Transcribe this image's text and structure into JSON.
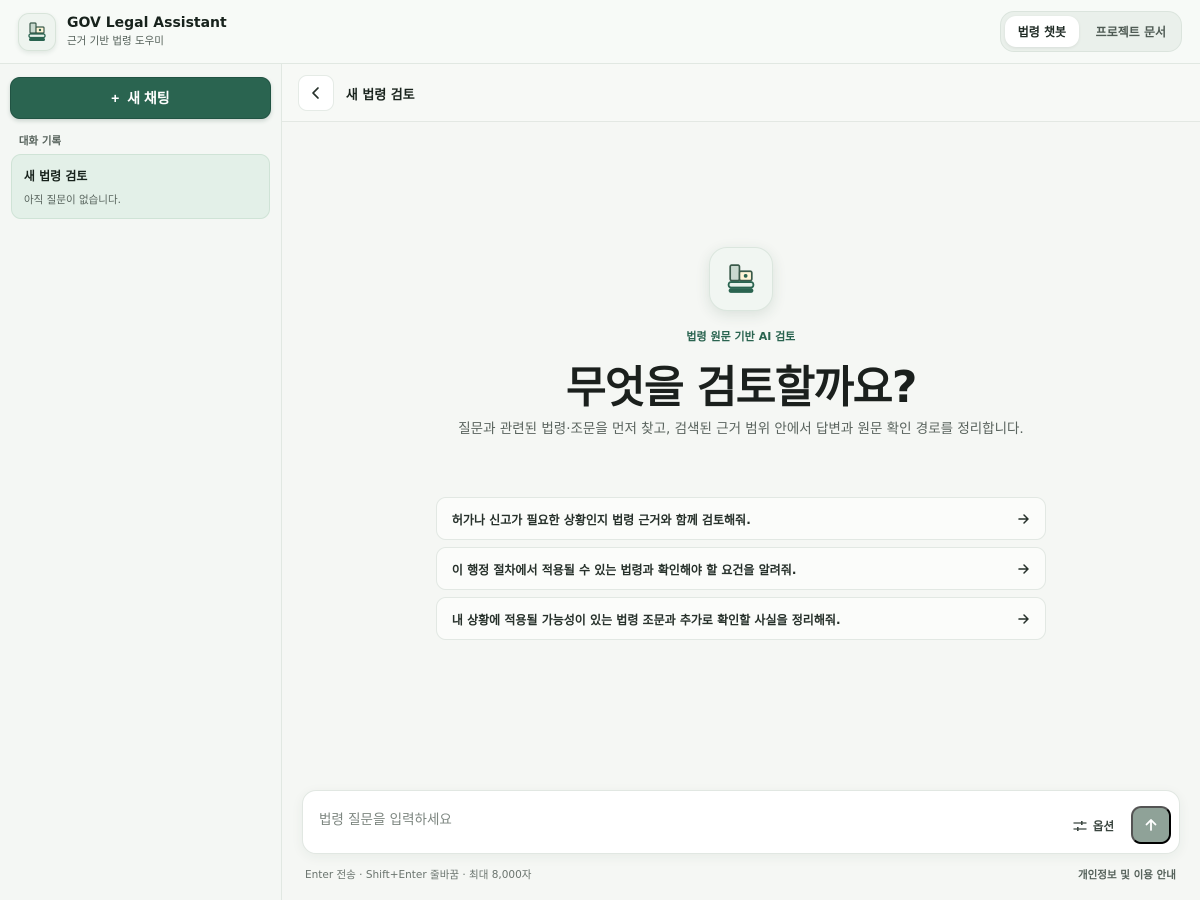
{
  "header": {
    "logo_icon": "law-book-icon",
    "title": "GOV Legal Assistant",
    "subtitle": "근거 기반 법령 도우미",
    "tabs": [
      {
        "label": "법령 챗봇",
        "active": true
      },
      {
        "label": "프로젝트 문서",
        "active": false
      }
    ]
  },
  "sidebar": {
    "new_chat_label": "새 채팅",
    "new_chat_icon": "+",
    "history_label": "대화 기록",
    "history": [
      {
        "title": "새 법령 검토",
        "subtitle": "아직 질문이 없습니다."
      }
    ]
  },
  "main": {
    "back_icon": "chevron-left-icon",
    "title": "새 법령 검토",
    "hero": {
      "icon": "law-book-icon",
      "eyebrow": "법령 원문 기반 AI 검토",
      "headline": "무엇을 검토할까요?",
      "lead": "질문과 관련된 법령·조문을 먼저 찾고, 검색된 근거 범위 안에서 답변과 원문 확인 경로를 정리합니다."
    },
    "suggestions": [
      {
        "text": "허가나 신고가 필요한 상황인지 법령 근거와 함께 검토해줘."
      },
      {
        "text": "이 행정 절차에서 적용될 수 있는 법령과 확인해야 할 요건을 알려줘."
      },
      {
        "text": "내 상황에 적용될 가능성이 있는 법령 조문과 추가로 확인할 사실을 정리해줘."
      }
    ]
  },
  "composer": {
    "placeholder": "법령 질문을 입력하세요",
    "value": "",
    "options_label": "옵션",
    "options_icon": "sliders-icon",
    "send_icon": "arrow-up-icon",
    "hint": "Enter 전송 · Shift+Enter 줄바꿈 · 최대 8,000자",
    "privacy_link": "개인정보 및 이용 안내"
  },
  "colors": {
    "accent": "#2a6450",
    "accent_light": "#e3f0e8",
    "send_disabled": "#8fa298",
    "background": "#f5f8f5"
  }
}
